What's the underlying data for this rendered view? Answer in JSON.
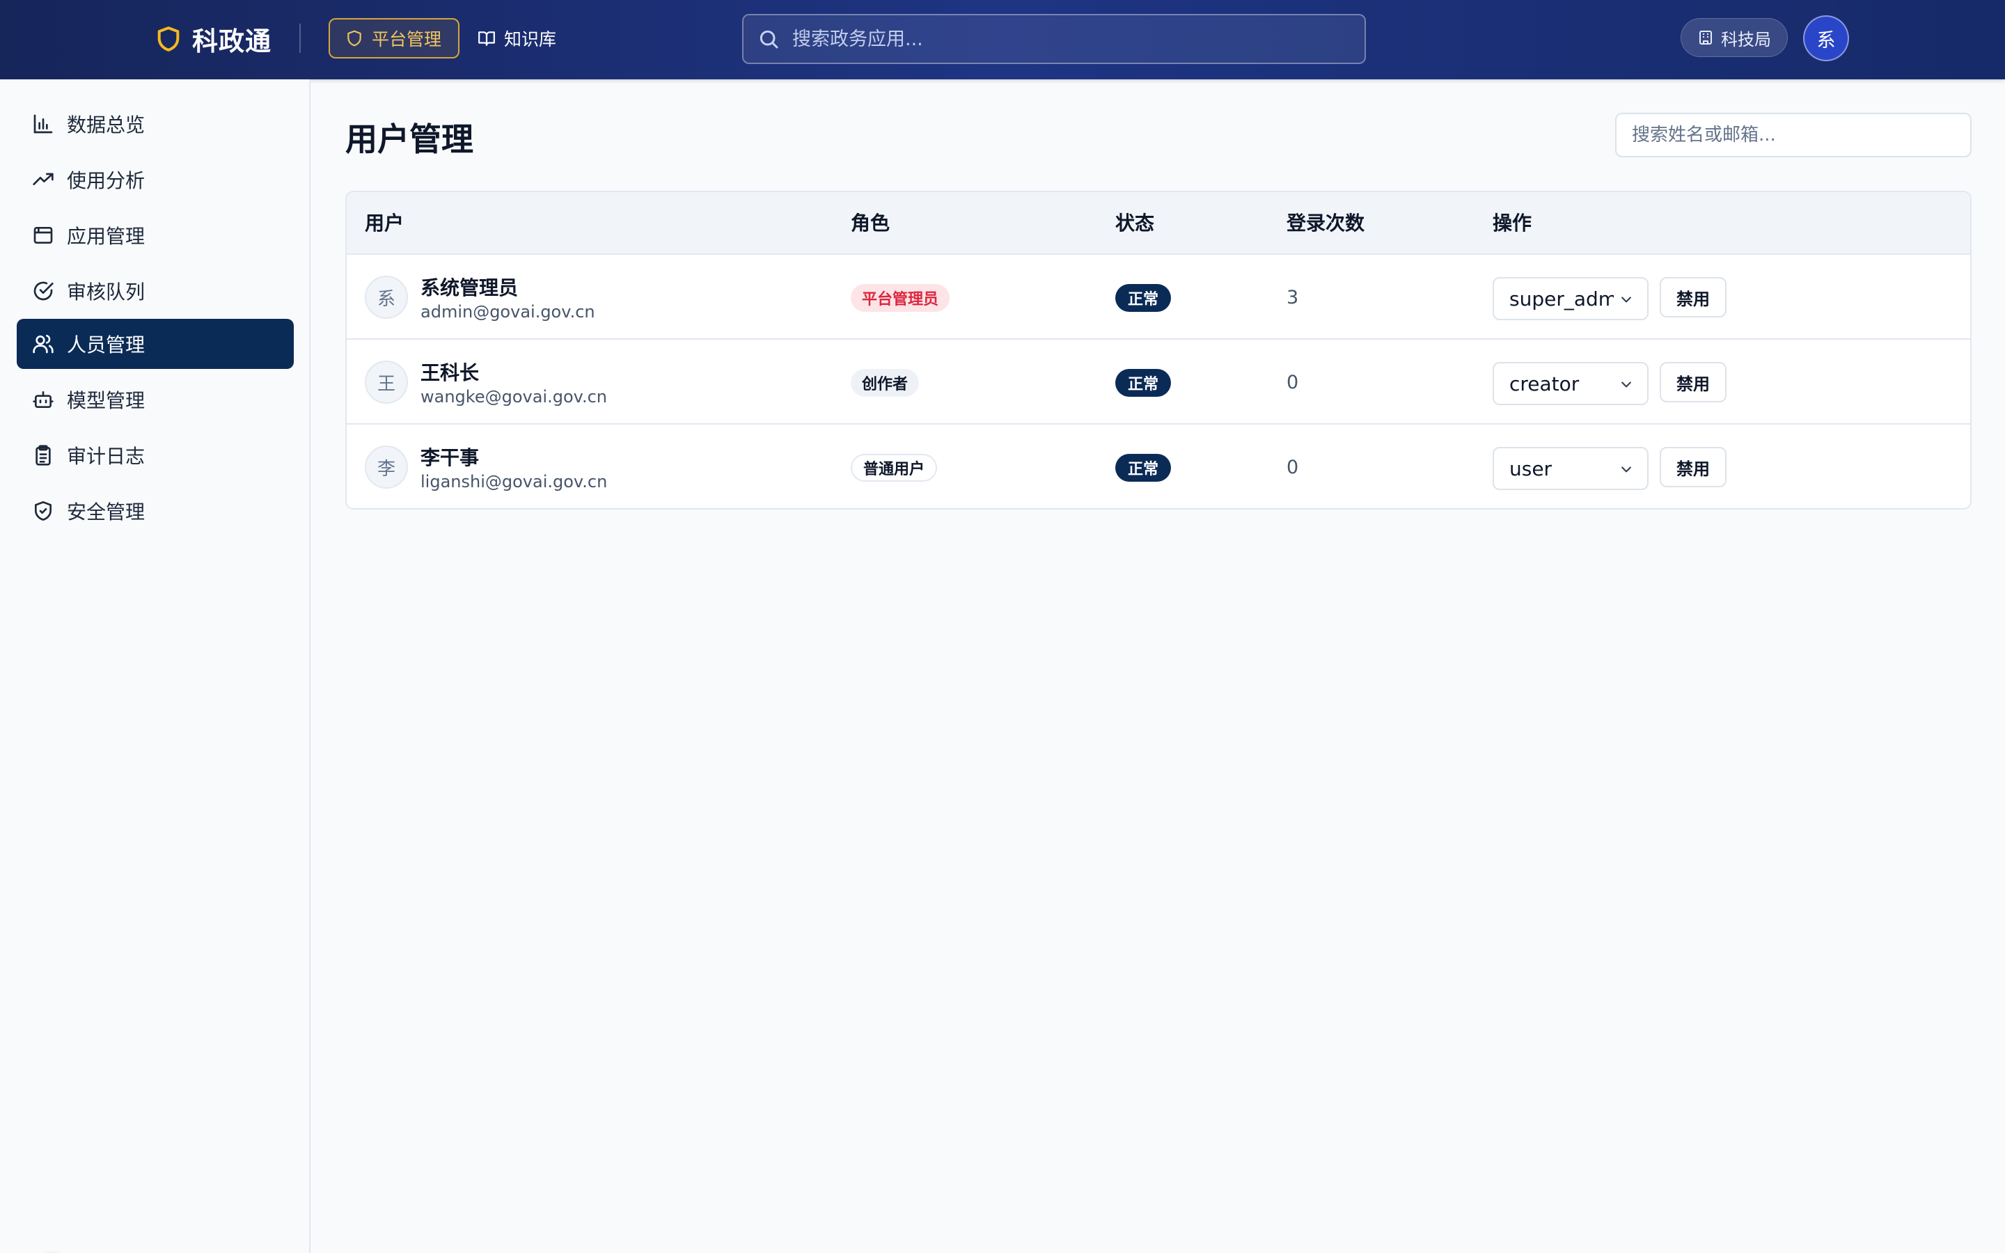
{
  "topbar": {
    "brand": "科政通",
    "nav": [
      {
        "label": "平台管理",
        "icon": "shield-icon",
        "active": true
      },
      {
        "label": "知识库",
        "icon": "book-open-icon",
        "active": false
      }
    ],
    "search_placeholder": "搜索政务应用...",
    "org_label": "科技局",
    "avatar_text": "系"
  },
  "sidebar": {
    "items": [
      {
        "label": "数据总览",
        "icon": "bar-chart-icon",
        "active": false
      },
      {
        "label": "使用分析",
        "icon": "trending-up-icon",
        "active": false
      },
      {
        "label": "应用管理",
        "icon": "app-window-icon",
        "active": false
      },
      {
        "label": "审核队列",
        "icon": "check-circle-icon",
        "active": false
      },
      {
        "label": "人员管理",
        "icon": "users-icon",
        "active": true
      },
      {
        "label": "模型管理",
        "icon": "bot-icon",
        "active": false
      },
      {
        "label": "审计日志",
        "icon": "clipboard-list-icon",
        "active": false
      },
      {
        "label": "安全管理",
        "icon": "shield-check-icon",
        "active": false
      }
    ]
  },
  "main": {
    "title": "用户管理",
    "search_placeholder": "搜索姓名或邮箱...",
    "table": {
      "headers": [
        "用户",
        "角色",
        "状态",
        "登录次数",
        "操作"
      ],
      "rows": [
        {
          "avatar": "系",
          "name": "系统管理员",
          "email": "admin@govai.gov.cn",
          "role": "平台管理员",
          "role_style": "admin",
          "status": "正常",
          "logins": "3",
          "role_select": "super_admin",
          "action": "禁用"
        },
        {
          "avatar": "王",
          "name": "王科长",
          "email": "wangke@govai.gov.cn",
          "role": "创作者",
          "role_style": "creator",
          "status": "正常",
          "logins": "0",
          "role_select": "creator",
          "action": "禁用"
        },
        {
          "avatar": "李",
          "name": "李干事",
          "email": "liganshi@govai.gov.cn",
          "role": "普通用户",
          "role_style": "user",
          "status": "正常",
          "logins": "0",
          "role_select": "user",
          "action": "禁用"
        }
      ]
    }
  },
  "colors": {
    "accent_navy": "#0b2b57",
    "topbar_blue": "#1f3483",
    "gold": "#f3c45c",
    "admin_badge_red": "#dc2640"
  }
}
